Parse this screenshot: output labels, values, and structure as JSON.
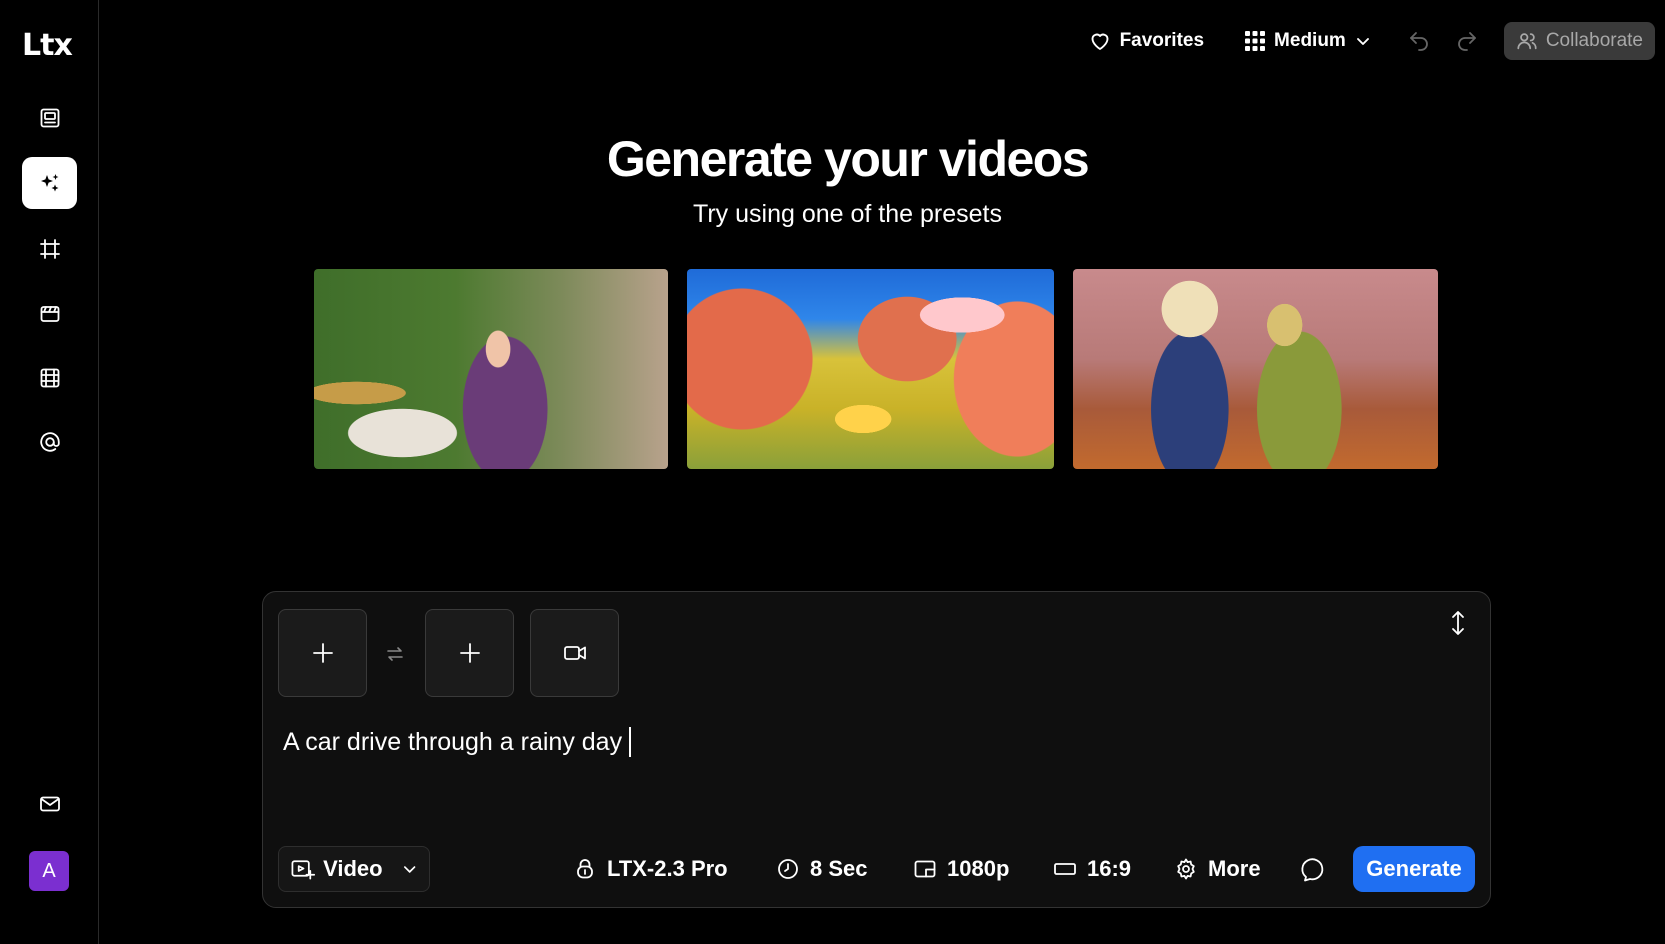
{
  "app": {
    "logo_text": "Ltx"
  },
  "sidebar": {
    "items": [
      {
        "name": "storyboard",
        "icon": "image-frame-icon"
      },
      {
        "name": "generate",
        "icon": "sparkles-icon",
        "active": true
      },
      {
        "name": "crop",
        "icon": "hash-frame-icon"
      },
      {
        "name": "clapper",
        "icon": "clapperboard-icon"
      },
      {
        "name": "film",
        "icon": "film-icon"
      },
      {
        "name": "mentions",
        "icon": "at-icon"
      }
    ],
    "bottom": {
      "mail_icon": "mail-icon",
      "avatar_letter": "A",
      "avatar_color": "#7b2fd0"
    }
  },
  "topbar": {
    "favorites_label": "Favorites",
    "size_label": "Medium",
    "collaborate_label": "Collaborate"
  },
  "hero": {
    "title": "Generate your videos",
    "subtitle": "Try using one of the presets"
  },
  "presets": [
    {
      "name": "drummer-preset"
    },
    {
      "name": "car-road-preset"
    },
    {
      "name": "two-women-preset"
    }
  ],
  "prompt": {
    "text": "A car drive through a rainy day"
  },
  "toolbar": {
    "mode_label": "Video",
    "model_label": "LTX-2.3 Pro",
    "duration_label": "8 Sec",
    "resolution_label": "1080p",
    "aspect_label": "16:9",
    "more_label": "More",
    "generate_label": "Generate"
  },
  "colors": {
    "accent": "#1f6ff2",
    "background": "#000000",
    "panel": "#0f0f0f"
  }
}
